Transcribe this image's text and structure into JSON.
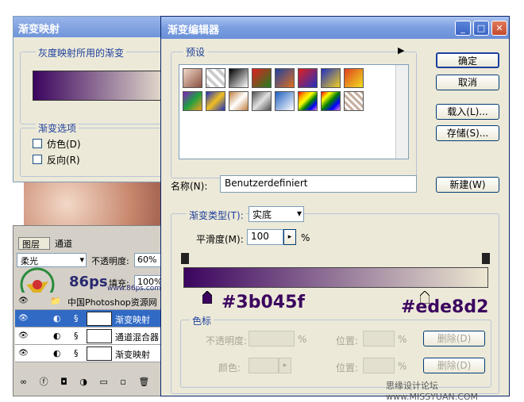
{
  "gradient_map": {
    "title": "渐变映射",
    "grayscale_label": "灰度映射所用的渐变",
    "options_label": "渐变选项",
    "dither_label": "仿色(D)",
    "reverse_label": "反向(R)"
  },
  "layers": {
    "tab_layers": "图层",
    "tab_channels": "通道",
    "blend_mode": "柔光",
    "opacity_label": "不透明度:",
    "opacity_value": "60%",
    "fill_label": "填充:",
    "fill_value": "100%",
    "group_name": "中国Photoshop资源网",
    "rows": [
      "渐变映射",
      "通道混合器",
      "渐变映射"
    ],
    "watermark": "86ps",
    "watermark_url": "www.86ps.com"
  },
  "editor": {
    "title": "渐变编辑器",
    "presets_label": "预设",
    "ok_button": "确定",
    "cancel_button": "取消",
    "load_button": "载入(L)...",
    "save_button": "存储(S)...",
    "name_label": "名称(N):",
    "name_value": "Benutzerdefiniert",
    "new_button": "新建(W)",
    "gradient_type_label": "渐变类型(T):",
    "gradient_type_value": "实底",
    "smoothness_label": "平滑度(M):",
    "smoothness_value": "100",
    "smoothness_unit": "%",
    "color_start": "#3b045f",
    "color_end": "#ede8d2",
    "stops_label": "色标",
    "opacity_label": "不透明度:",
    "location_label": "位置:",
    "percent": "%",
    "delete_label": "删除(D)",
    "color_label": "颜色:",
    "minimize_icon": "minimize-icon",
    "maximize_icon": "maximize-icon",
    "close_icon": "close-icon"
  },
  "footer_watermark": "思缘设计论坛 www.MISSYUAN.COM"
}
